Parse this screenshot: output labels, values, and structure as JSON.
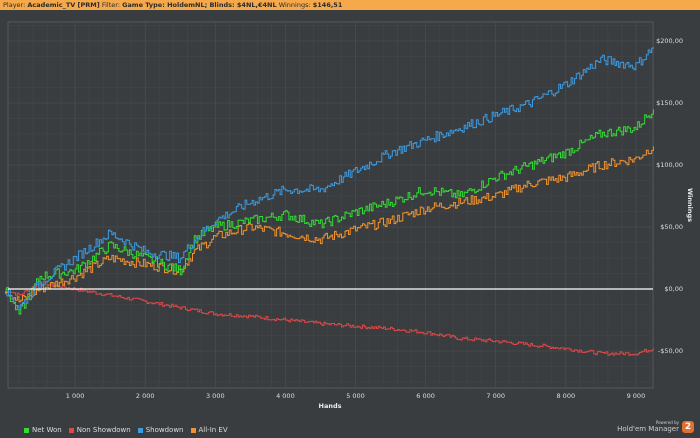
{
  "header": {
    "player_label": "Player:",
    "player": "Academic_TV [PRM]",
    "filter_label": "Filter:",
    "filter": "Game Type: HoldemNL; Blinds: $4NL,€4NL",
    "winnings_label": "Winnings:",
    "winnings": "$146,51"
  },
  "chart_data": {
    "type": "line",
    "xlabel": "Hands",
    "ylabel": "Winnings",
    "xlim": [
      0,
      9300
    ],
    "ylim": [
      -75,
      220
    ],
    "xticks": [
      1000,
      2000,
      3000,
      4000,
      5000,
      6000,
      7000,
      8000,
      9000
    ],
    "xtick_labels": [
      "1 000",
      "2 000",
      "3 000",
      "4 000",
      "5 000",
      "6 000",
      "7 000",
      "8 000",
      "9 000"
    ],
    "yticks": [
      -50,
      0,
      50,
      100,
      150,
      200
    ],
    "ytick_labels": [
      "-$50,00",
      "$0,00",
      "$50,00",
      "$100,00",
      "$150,00",
      "$200,00"
    ],
    "x": [
      0,
      200,
      500,
      1000,
      1500,
      2000,
      2500,
      2700,
      3000,
      3500,
      4000,
      4500,
      5000,
      5500,
      6000,
      6500,
      7000,
      7500,
      8000,
      8500,
      9000,
      9250
    ],
    "series": [
      {
        "name": "Net Won",
        "color": "#33dd33",
        "values": [
          0,
          -20,
          10,
          15,
          35,
          25,
          15,
          40,
          50,
          55,
          60,
          52,
          62,
          70,
          80,
          75,
          90,
          100,
          110,
          125,
          130,
          145
        ]
      },
      {
        "name": "Non Showdown",
        "color": "#e04848",
        "values": [
          0,
          -5,
          5,
          0,
          -5,
          -10,
          -15,
          -17,
          -20,
          -22,
          -25,
          -28,
          -30,
          -32,
          -35,
          -40,
          -42,
          -45,
          -48,
          -52,
          -52,
          -48
        ]
      },
      {
        "name": "Showdown",
        "color": "#3d9be0",
        "values": [
          0,
          -15,
          5,
          25,
          45,
          30,
          25,
          40,
          55,
          70,
          80,
          80,
          95,
          110,
          120,
          130,
          140,
          150,
          165,
          185,
          180,
          195
        ]
      },
      {
        "name": "All-In EV",
        "color": "#f0922e",
        "values": [
          0,
          -10,
          0,
          10,
          25,
          20,
          15,
          30,
          42,
          50,
          45,
          40,
          48,
          55,
          65,
          70,
          75,
          85,
          90,
          100,
          105,
          115
        ]
      }
    ],
    "legend_position": "bottom-left"
  },
  "branding": {
    "powered": "Powered by",
    "name": "Hold'em Manager",
    "logo": "2"
  }
}
